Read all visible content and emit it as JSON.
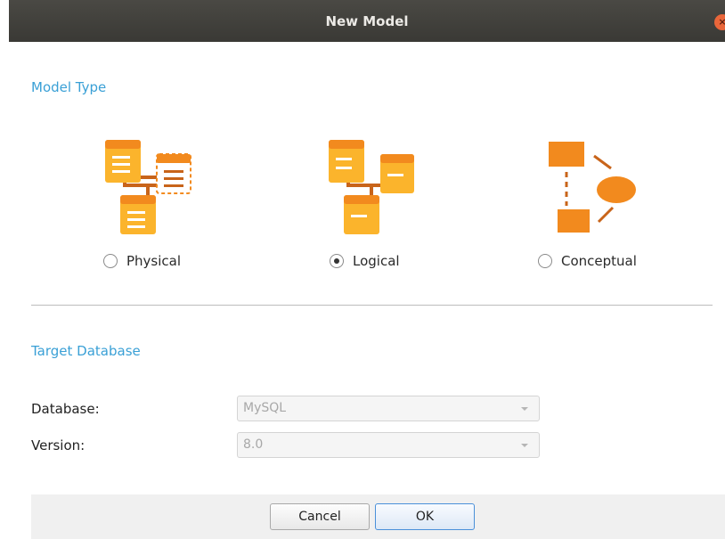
{
  "window": {
    "title": "New Model",
    "close_glyph": "×"
  },
  "model_type": {
    "section_title": "Model Type",
    "options": [
      {
        "label": "Physical",
        "checked": false,
        "icon": "physical-model-icon"
      },
      {
        "label": "Logical",
        "checked": true,
        "icon": "logical-model-icon"
      },
      {
        "label": "Conceptual",
        "checked": false,
        "icon": "conceptual-model-icon"
      }
    ]
  },
  "target_database": {
    "section_title": "Target Database",
    "database_label": "Database:",
    "database_value": "MySQL",
    "version_label": "Version:",
    "version_value": "8.0"
  },
  "buttons": {
    "cancel": "Cancel",
    "ok": "OK"
  },
  "colors": {
    "accent": "#3aa0d6",
    "icon_orange": "#f28a1e",
    "icon_yellow": "#fbb42c"
  }
}
